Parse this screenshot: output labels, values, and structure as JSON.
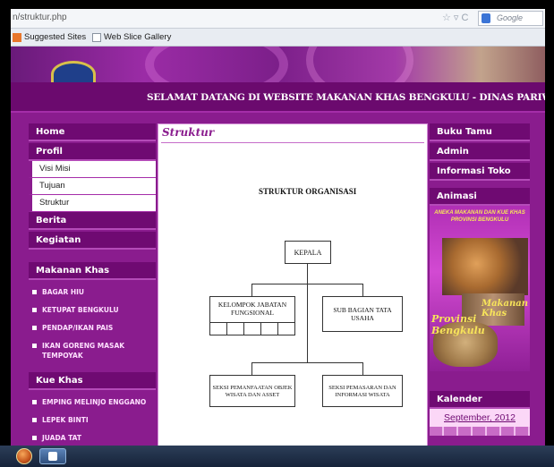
{
  "browser": {
    "url": "n/struktur.php",
    "nav_glyphs": "☆ ▿ C",
    "search_placeholder": "Google",
    "favorites": [
      {
        "label": "Suggested Sites",
        "icon": "suggested-sites-icon"
      },
      {
        "label": "Web Slice Gallery",
        "icon": "web-slice-icon"
      }
    ]
  },
  "header": {
    "welcome_text": "SELAMAT DATANG DI WEBSITE MAKANAN KHAS BENGKULU - DINAS PARIWISATA DAN KEBUDA"
  },
  "left_menu": {
    "main": [
      {
        "label": "Home"
      },
      {
        "label": "Profil"
      }
    ],
    "profil_sub": [
      {
        "label": "Visi Misi"
      },
      {
        "label": "Tujuan"
      },
      {
        "label": "Struktur"
      }
    ],
    "after": [
      {
        "label": "Berita"
      },
      {
        "label": "Kegiatan"
      }
    ],
    "makanan_khas": {
      "title": "Makanan Khas",
      "items": [
        "BAGAR HIU",
        "KETUPAT BENGKULU",
        "PENDAP/IKAN PAIS",
        "IKAN GORENG MASAK TEMPOYAK"
      ]
    },
    "kue_khas": {
      "title": "Kue Khas",
      "items": [
        "EMPING MELINJO ENGGANO",
        "LEPEK BINTI",
        "JUADA TAT"
      ]
    }
  },
  "content": {
    "title": "Struktur",
    "org_heading": "STRUKTUR ORGANISASI",
    "kepala": "KEPALA",
    "kelompok_jabatan": "KELOMPOK JABATAN FUNGSIONAL",
    "sub_bagian": "SUB BAGIAN TATA USAHA",
    "seksi_pemanfaatan": "SEKSI PEMANFAATAN OBJEK WISATA DAN ASSET",
    "seksi_pemasaran": "SEKSI PEMASARAN DAN INFORMASI WISATA"
  },
  "right_menu": {
    "items": [
      {
        "label": "Buku Tamu"
      },
      {
        "label": "Admin"
      },
      {
        "label": "Informasi Toko"
      }
    ],
    "animasi": {
      "title": "Animasi",
      "caption": "ANEKA MAKANAN DAN KUE KHAS PROVINSI BENGKULU",
      "overlay_1": "Makanan Khas",
      "overlay_2": "Provinsi Bengkulu"
    },
    "kalender": {
      "title": "Kalender",
      "month": "September, 2012"
    }
  },
  "colors": {
    "menu_bg": "#6f0a72",
    "page_bg": "#8a1c8e",
    "accent_gold": "#f7e45a"
  }
}
